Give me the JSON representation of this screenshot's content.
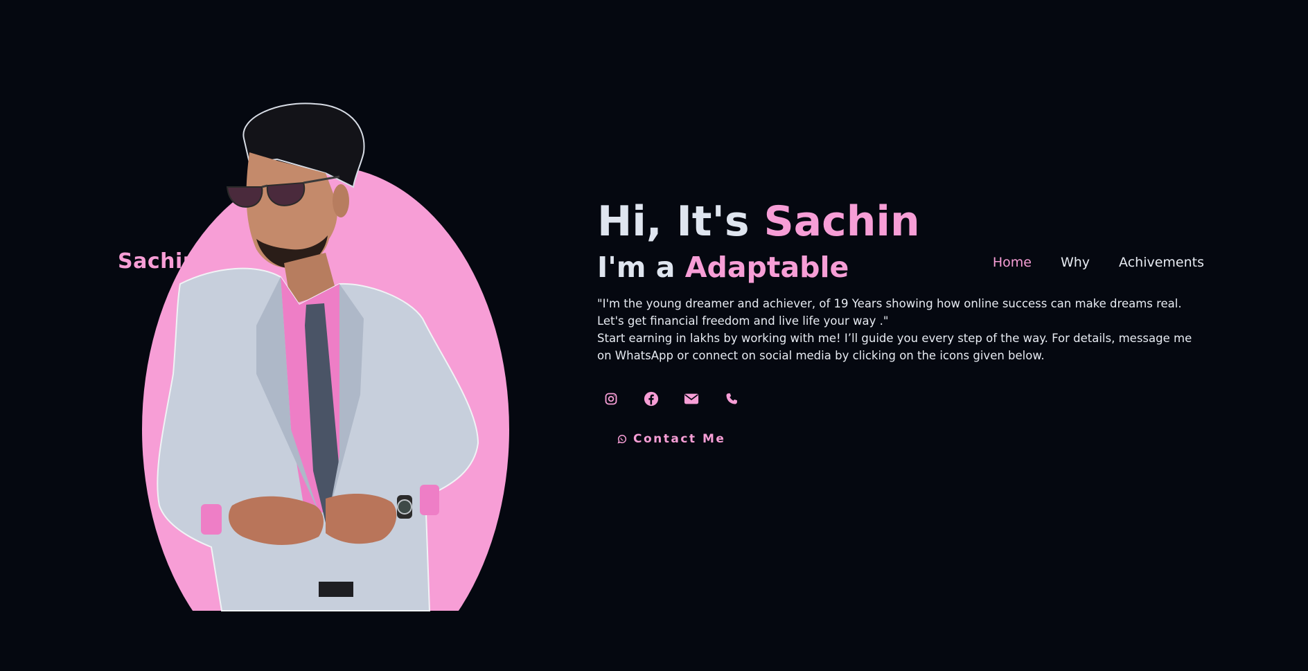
{
  "brand": {
    "logo_text": "Sachin"
  },
  "nav": {
    "items": [
      {
        "label": "Home",
        "active": true
      },
      {
        "label": "Why",
        "active": false
      },
      {
        "label": "Achivements",
        "active": false
      }
    ]
  },
  "hero": {
    "greeting_prefix": "Hi, It's ",
    "name": "Sachin",
    "role_prefix": "I'm a ",
    "role": "Adaptable",
    "bio_line1": "\"I'm the young dreamer and achiever, of 19 Years showing how online success can make dreams real. Let's get financial freedom and live life your way .\"",
    "bio_line2": "Start earning in lakhs by working with me! I’ll guide you every step of the way. For details, message me on WhatsApp or connect on social media by clicking on the icons given below."
  },
  "socials": [
    {
      "icon": "instagram-icon"
    },
    {
      "icon": "facebook-icon"
    },
    {
      "icon": "envelope-icon"
    },
    {
      "icon": "phone-icon"
    }
  ],
  "contact_button": {
    "label": "Contact Me",
    "icon": "whatsapp-icon"
  },
  "colors": {
    "background": "#050810",
    "accent": "#f79ed6",
    "text": "#e7ebf2"
  }
}
